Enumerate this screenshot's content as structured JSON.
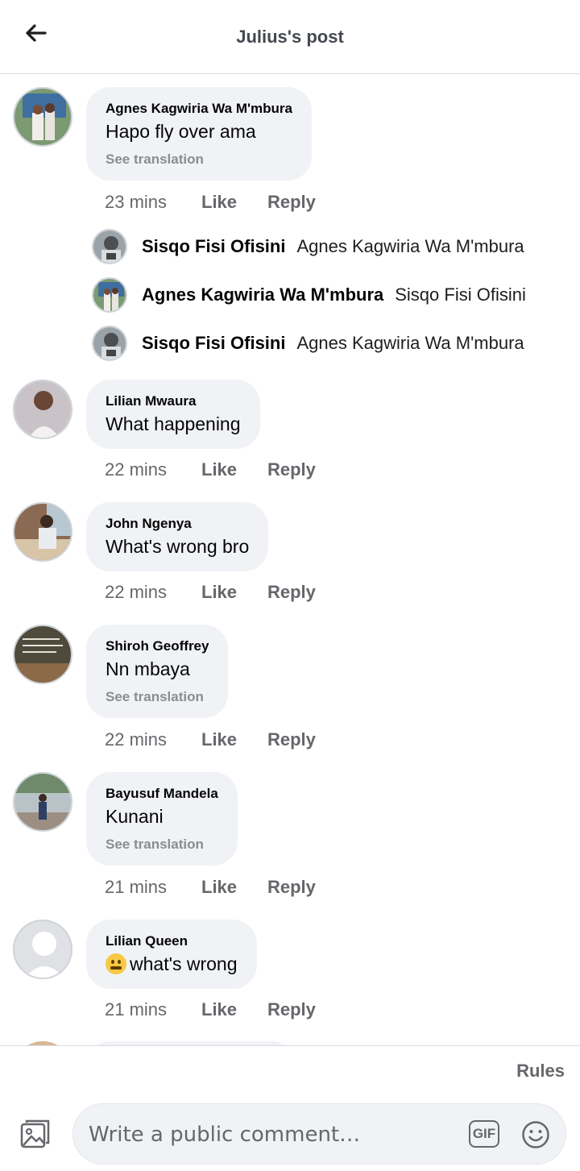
{
  "header": {
    "title": "Julius's post"
  },
  "comments": [
    {
      "author": "Agnes Kagwiria Wa M'mbura",
      "text": "Hapo fly over ama",
      "translate": "See translation",
      "time": "23 mins",
      "like": "Like",
      "reply": "Reply"
    },
    {
      "author": "Lilian Mwaura",
      "text": "What happening",
      "time": "22 mins",
      "like": "Like",
      "reply": "Reply"
    },
    {
      "author": "John Ngenya",
      "text": "What's wrong bro",
      "time": "22 mins",
      "like": "Like",
      "reply": "Reply"
    },
    {
      "author": "Shiroh Geoffrey",
      "text": "Nn mbaya",
      "translate": "See translation",
      "time": "22 mins",
      "like": "Like",
      "reply": "Reply"
    },
    {
      "author": "Bayusuf Mandela",
      "text": "Kunani",
      "translate": "See translation",
      "time": "21 mins",
      "like": "Like",
      "reply": "Reply"
    },
    {
      "author": "Lilian Queen",
      "text": "what's wrong",
      "time": "21 mins",
      "like": "Like",
      "reply": "Reply"
    }
  ],
  "replies": [
    {
      "author": "Sisqo Fisi Ofisini",
      "snippet": "Agnes Kagwiria Wa M'mbura"
    },
    {
      "author": "Agnes Kagwiria Wa M'mbura",
      "snippet": "Sisqo Fisi Ofisini"
    },
    {
      "author": "Sisqo Fisi Ofisini",
      "snippet": "Agnes Kagwiria Wa M'mbura"
    }
  ],
  "footer": {
    "rules": "Rules",
    "placeholder": "Write a public comment…",
    "gif": "GIF"
  },
  "icons": {
    "back": "arrow-left-icon",
    "photo": "photo-icon",
    "gif": "gif-icon",
    "emoji": "smiley-icon"
  },
  "colors": {
    "bubble": "#f0f2f5",
    "secondary_text": "#65676b",
    "translate_text": "#8a8d91"
  }
}
